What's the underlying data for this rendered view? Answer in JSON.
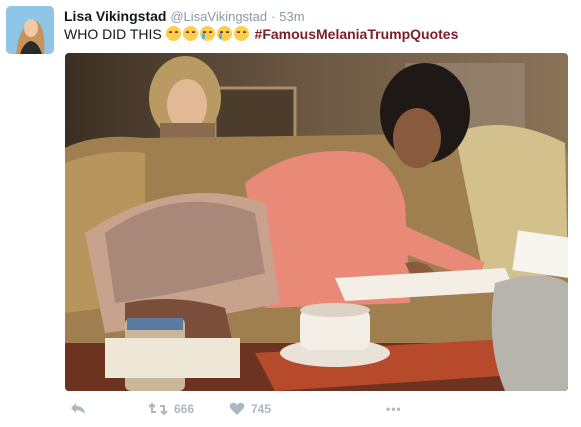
{
  "tweet": {
    "author_name": "Lisa Vikingstad",
    "handle": "@LisaVikingstad",
    "separator": "·",
    "time": "53m",
    "text": "WHO DID THIS",
    "emojis": [
      "joy-emoji",
      "joy-emoji",
      "loudly-crying-emoji",
      "loudly-crying-emoji",
      "joy-emoji"
    ],
    "hashtag": "#FamousMelaniaTrumpQuotes"
  },
  "actions": {
    "retweet_count": "666",
    "like_count": "745",
    "more_label": "•••"
  },
  "icons": {
    "reply": "reply-icon",
    "retweet": "retweet-icon",
    "like": "heart-icon",
    "more": "more-dots-icon"
  },
  "colors": {
    "hashtag": "#7c1d2c",
    "muted": "#8899a6",
    "count": "#aab8c2"
  }
}
